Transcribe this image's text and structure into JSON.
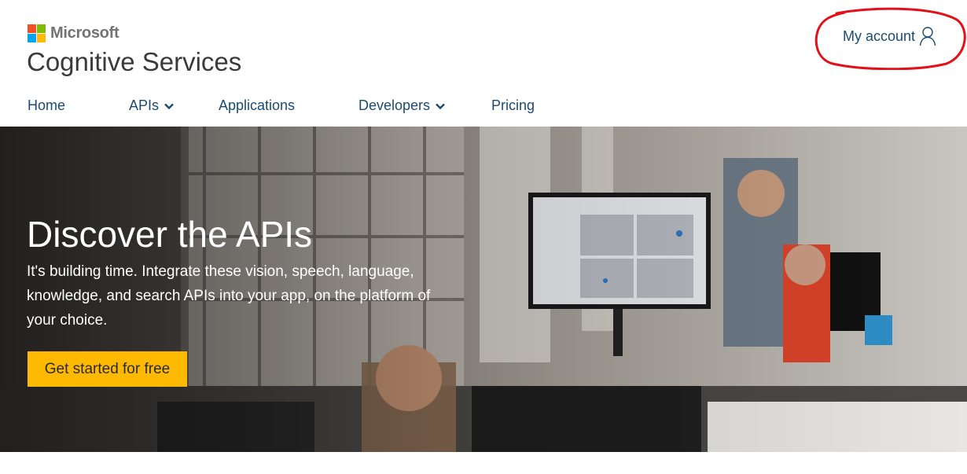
{
  "brand": {
    "company": "Microsoft",
    "product": "Cognitive Services"
  },
  "account": {
    "label": "My account",
    "icon": "user-icon"
  },
  "nav": [
    {
      "label": "Home",
      "has_dropdown": false
    },
    {
      "label": "APIs",
      "has_dropdown": true
    },
    {
      "label": "Applications",
      "has_dropdown": false
    },
    {
      "label": "Developers",
      "has_dropdown": true
    },
    {
      "label": "Pricing",
      "has_dropdown": false
    }
  ],
  "hero": {
    "title": "Discover the APIs",
    "subtitle": "It's building time. Integrate these vision, speech, language, knowledge, and search APIs into your app, on the platform of your choice.",
    "cta": "Get started for free"
  },
  "colors": {
    "nav_text": "#1b4b72",
    "cta_bg": "#ffb900",
    "annotation": "#e3101a"
  }
}
